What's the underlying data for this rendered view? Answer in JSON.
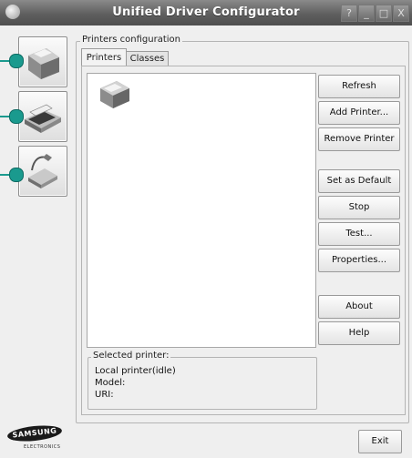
{
  "window": {
    "title": "Unified Driver Configurator"
  },
  "titlebar_buttons": [
    "?",
    "_",
    "□",
    "X"
  ],
  "sidebar": {
    "items": [
      {
        "name": "printers",
        "icon": "printer-icon"
      },
      {
        "name": "scanners",
        "icon": "scanner-icon"
      },
      {
        "name": "ports",
        "icon": "port-icon"
      }
    ]
  },
  "group": {
    "title": "Printers configuration"
  },
  "tabs": [
    {
      "label": "Printers",
      "active": true
    },
    {
      "label": "Classes",
      "active": false
    }
  ],
  "actions": {
    "refresh": "Refresh",
    "add_printer": "Add Printer...",
    "remove_printer": "Remove Printer",
    "set_default": "Set as Default",
    "stop": "Stop",
    "test": "Test...",
    "properties": "Properties...",
    "about": "About",
    "help": "Help"
  },
  "selected": {
    "title": "Selected printer:",
    "status": "Local printer(idle)",
    "model": "Model:",
    "uri": "URI:"
  },
  "footer": {
    "exit": "Exit"
  },
  "logo": {
    "brand": "SAMSUNG",
    "sub": "ELECTRONICS"
  },
  "colors": {
    "accent": "#1a9a8e",
    "titlebar": "#5f5f5f"
  }
}
